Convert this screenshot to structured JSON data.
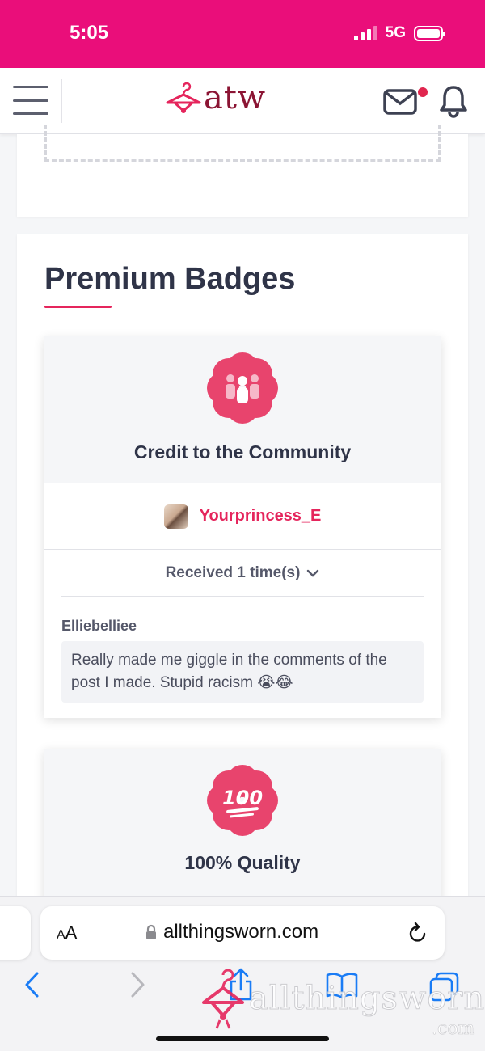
{
  "status_bar": {
    "time": "5:05",
    "network": "5G",
    "bg_color": "#ea0e7a"
  },
  "header": {
    "logo_text": "atw",
    "menu_icon": "hamburger-icon",
    "mail_icon": "mail-icon",
    "notification_icon": "bell-icon",
    "unread_dot_color": "#e0264f"
  },
  "premium": {
    "title": "Premium Badges",
    "accent_color": "#e5255c",
    "badges": [
      {
        "name": "Credit to the Community",
        "icon": "community-badge-icon",
        "giver": "Yourprincess_E",
        "received_label": "Received 1 time(s)",
        "comment_author": "Elliebelliee",
        "comment_text": "Really made me giggle in the comments of the post I made. Stupid racism 😭😂"
      },
      {
        "name": "100% Quality",
        "icon": "hundred-badge-icon",
        "icon_text": "100"
      }
    ]
  },
  "browser": {
    "aa_label_small": "A",
    "aa_label_large": "A",
    "url": "allthingsworn.com",
    "watermark": "allthingsworn",
    "watermark_suffix": ".com"
  }
}
